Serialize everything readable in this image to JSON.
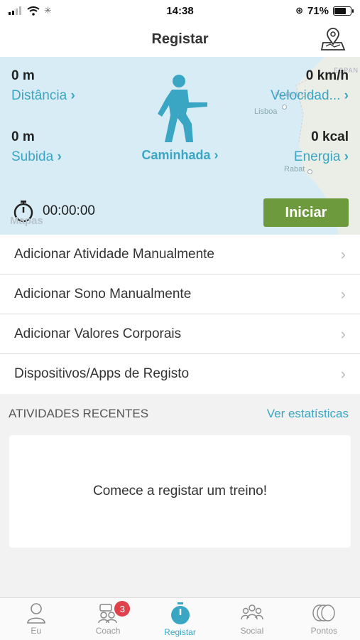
{
  "status_bar": {
    "time": "14:38",
    "battery": "71%",
    "battery_level": 0.71
  },
  "header": {
    "title": "Registar",
    "map_icon": "map-pin-icon"
  },
  "map": {
    "region": "ESPAN",
    "region2": "PORTUGAL",
    "cities": [
      "Lisboa",
      "Rabat"
    ],
    "attribution": "Mapas"
  },
  "metrics": {
    "distance": {
      "value": "0 m",
      "label": "Distância"
    },
    "speed": {
      "value": "0 km/h",
      "label": "Velocidad..."
    },
    "ascent": {
      "value": "0 m",
      "label": "Subida"
    },
    "energy": {
      "value": "0 kcal",
      "label": "Energia"
    }
  },
  "activity": {
    "label": "Caminhada",
    "icon": "walking-person-icon"
  },
  "timer": {
    "value": "00:00:00",
    "icon": "stopwatch-icon"
  },
  "start_button": {
    "label": "Iniciar"
  },
  "actions": [
    {
      "label": "Adicionar Atividade Manualmente"
    },
    {
      "label": "Adicionar Sono Manualmente"
    },
    {
      "label": "Adicionar Valores Corporais"
    },
    {
      "label": "Dispositivos/Apps de Registo"
    }
  ],
  "recent": {
    "title": "ATIVIDADES RECENTES",
    "stats_link": "Ver estatísticas",
    "empty_message": "Comece a registar um treino!"
  },
  "tabs": [
    {
      "label": "Eu",
      "icon": "person-icon"
    },
    {
      "label": "Coach",
      "icon": "coach-icon",
      "badge": "3"
    },
    {
      "label": "Registar",
      "icon": "stopwatch-icon"
    },
    {
      "label": "Social",
      "icon": "group-icon"
    },
    {
      "label": "Pontos",
      "icon": "coins-icon"
    }
  ],
  "colors": {
    "accent": "#3aa6c4",
    "start": "#6d9a3d",
    "badge": "#e0414a",
    "map": "#d8ecf6"
  }
}
